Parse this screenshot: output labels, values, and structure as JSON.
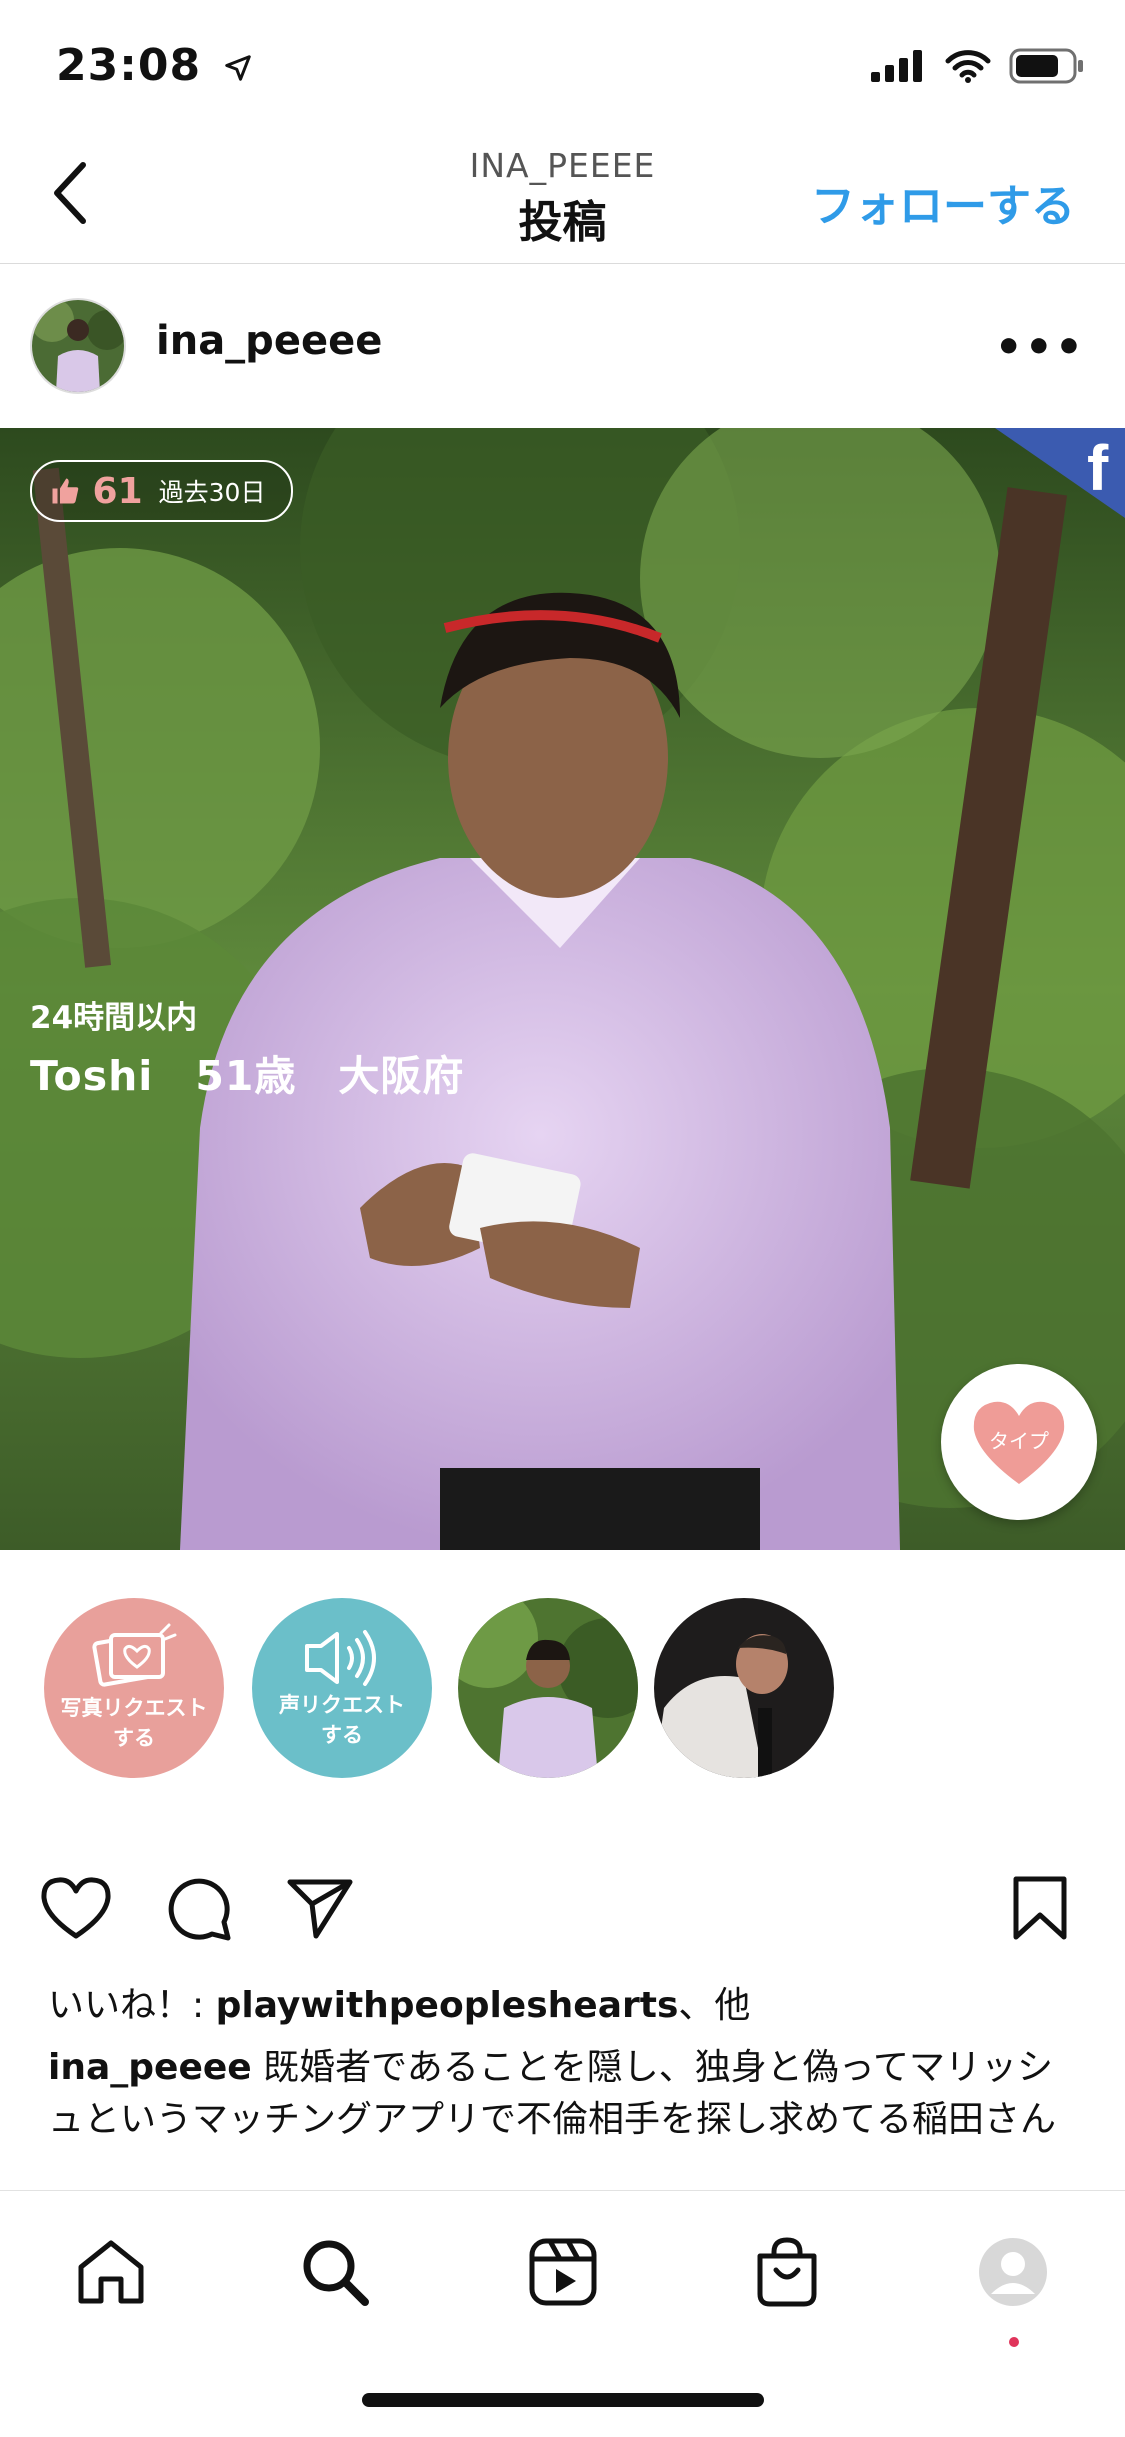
{
  "status_bar": {
    "time": "23:08"
  },
  "header": {
    "subtitle": "INA_PEEEE",
    "title": "投稿",
    "follow_label": "フォローする"
  },
  "post": {
    "username": "ina_peeee",
    "more_label": "•••",
    "photo": {
      "like_count": "61",
      "like_period": "過去30日",
      "time_label": "24時間以内",
      "profile_info": "Toshi　51歳　大阪府",
      "type_button_label": "タイプ"
    },
    "circles": [
      {
        "label_line1": "写真リクエスト",
        "label_line2": "する"
      },
      {
        "label_line1": "声リクエスト",
        "label_line2": "する"
      }
    ],
    "likes_prefix": "いいね！: ",
    "likes_user": "playwithpeopleshearts",
    "likes_suffix": "、他",
    "caption_user": "ina_peeee",
    "caption_text": " 既婚者であることを隠し、独身と偽ってマリッシュというマッチングアプリで不倫相手を探し求めてる稲田さん"
  },
  "colors": {
    "accent_blue": "#2f9be8",
    "pink_circle": "#e8a09b",
    "teal_circle": "#6bbfc9",
    "profile_dot": "#e0345b"
  },
  "icons": [
    "back-chevron",
    "heart",
    "comment",
    "send",
    "bookmark",
    "home",
    "search",
    "reels",
    "shop",
    "profile"
  ]
}
